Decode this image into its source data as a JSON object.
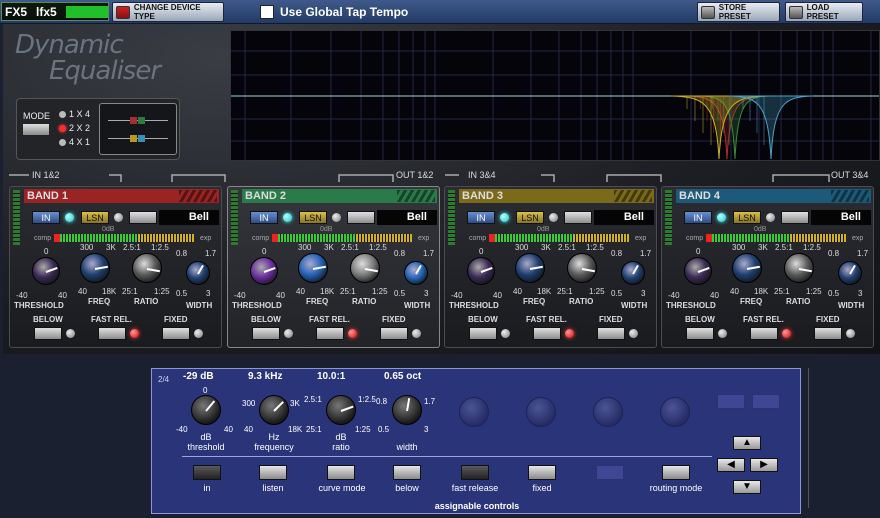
{
  "topbar": {
    "fx_tag": "FX5",
    "fx_name": "lfx5",
    "change_device_type": "CHANGE DEVICE TYPE",
    "global_tap_tempo": "Use Global Tap Tempo",
    "store_preset": "STORE PRESET",
    "load_preset": "LOAD PRESET"
  },
  "plugin": {
    "logo_line1": "Dynamic",
    "logo_line2": "Equaliser",
    "mode_label": "MODE",
    "mode_options": [
      "1 X 4",
      "2 X 2",
      "4 X 1"
    ],
    "mode_selected": "2 X 2",
    "routing_numbers": [
      "1",
      "2",
      "3",
      "4"
    ],
    "route_labels": [
      "IN 1&2",
      "OUT 1&2",
      "IN 3&4",
      "OUT 3&4"
    ]
  },
  "graph": {
    "curve_colors": [
      "#b52a2a",
      "#3a8a3a",
      "#c7b12b",
      "#4aa3c8"
    ]
  },
  "bands": [
    {
      "title": "BAND 1",
      "color": "#9a2323",
      "in": "IN",
      "listen": "LSN",
      "shape": "Bell",
      "zero_db": "0dB",
      "comp": "comp",
      "exp": "exp",
      "threshold_label": "THRESHOLD",
      "freq_label": "FREQ",
      "ratio_label": "RATIO",
      "width_label": "WIDTH",
      "th_min": "-40",
      "th_max": "40",
      "th_mid": "0",
      "fr_a": "300",
      "fr_b": "3K",
      "fr_min": "40",
      "fr_max": "18K",
      "ra_a": "2.5:1",
      "ra_b": "1:2.5",
      "ra_min": "25:1",
      "ra_max": "1:25",
      "wi_a": "0.8",
      "wi_b": "1.7",
      "wi_min": "0.5",
      "wi_max": "3",
      "below": "BELOW",
      "fast_rel": "FAST REL.",
      "fixed": "FIXED",
      "active": false
    },
    {
      "title": "BAND 2",
      "color": "#2a7a4a",
      "in": "IN",
      "listen": "LSN",
      "shape": "Bell",
      "zero_db": "0dB",
      "comp": "comp",
      "exp": "exp",
      "threshold_label": "THRESHOLD",
      "freq_label": "FREQ",
      "ratio_label": "RATIO",
      "width_label": "WIDTH",
      "th_min": "-40",
      "th_max": "40",
      "th_mid": "0",
      "fr_a": "300",
      "fr_b": "3K",
      "fr_min": "40",
      "fr_max": "18K",
      "ra_a": "2.5:1",
      "ra_b": "1:2.5",
      "ra_min": "25:1",
      "ra_max": "1:25",
      "wi_a": "0.8",
      "wi_b": "1.7",
      "wi_min": "0.5",
      "wi_max": "3",
      "below": "BELOW",
      "fast_rel": "FAST REL.",
      "fixed": "FIXED",
      "active": true
    },
    {
      "title": "BAND 3",
      "color": "#7a6a1a",
      "in": "IN",
      "listen": "LSN",
      "shape": "Bell",
      "zero_db": "0dB",
      "comp": "comp",
      "exp": "exp",
      "threshold_label": "THRESHOLD",
      "freq_label": "FREQ",
      "ratio_label": "RATIO",
      "width_label": "WIDTH",
      "th_min": "-40",
      "th_max": "40",
      "th_mid": "0",
      "fr_a": "300",
      "fr_b": "3K",
      "fr_min": "40",
      "fr_max": "18K",
      "ra_a": "2.5:1",
      "ra_b": "1:2.5",
      "ra_min": "25:1",
      "ra_max": "1:25",
      "wi_a": "0.8",
      "wi_b": "1.7",
      "wi_min": "0.5",
      "wi_max": "3",
      "below": "BELOW",
      "fast_rel": "FAST REL.",
      "fixed": "FIXED",
      "active": false
    },
    {
      "title": "BAND 4",
      "color": "#1d5a7a",
      "in": "IN",
      "listen": "LSN",
      "shape": "Bell",
      "zero_db": "0dB",
      "comp": "comp",
      "exp": "exp",
      "threshold_label": "THRESHOLD",
      "freq_label": "FREQ",
      "ratio_label": "RATIO",
      "width_label": "WIDTH",
      "th_min": "-40",
      "th_max": "40",
      "th_mid": "0",
      "fr_a": "300",
      "fr_b": "3K",
      "fr_min": "40",
      "fr_max": "18K",
      "ra_a": "2.5:1",
      "ra_b": "1:2.5",
      "ra_min": "25:1",
      "ra_max": "1:25",
      "wi_a": "0.8",
      "wi_b": "1.7",
      "wi_min": "0.5",
      "wi_max": "3",
      "below": "BELOW",
      "fast_rel": "FAST REL.",
      "fixed": "FIXED",
      "active": false
    }
  ],
  "assign": {
    "page": "2/4",
    "values": [
      "-29 dB",
      "9.3 kHz",
      "10.0:1",
      "0.65 oct"
    ],
    "th_mid": "0",
    "th_min": "-40",
    "th_max": "40",
    "th_unit": "dB",
    "th_name": "threshold",
    "fr_a": "300",
    "fr_b": "3K",
    "fr_min": "40",
    "fr_max": "18K",
    "fr_unit": "Hz",
    "fr_name": "frequency",
    "ra_a": "2.5:1",
    "ra_b": "1:2.5",
    "ra_min": "25:1",
    "ra_max": "1:25",
    "ra_unit": "dB",
    "ra_name": "ratio",
    "wi_a": "0.8",
    "wi_b": "1.7",
    "wi_min": "0.5",
    "wi_max": "3",
    "wi_name": "width",
    "buttons": [
      "in",
      "listen",
      "curve mode",
      "below",
      "fast release",
      "fixed",
      "routing mode"
    ],
    "footer": "assignable controls",
    "arrows": [
      "▲",
      "◀",
      "▶",
      "▼"
    ]
  }
}
